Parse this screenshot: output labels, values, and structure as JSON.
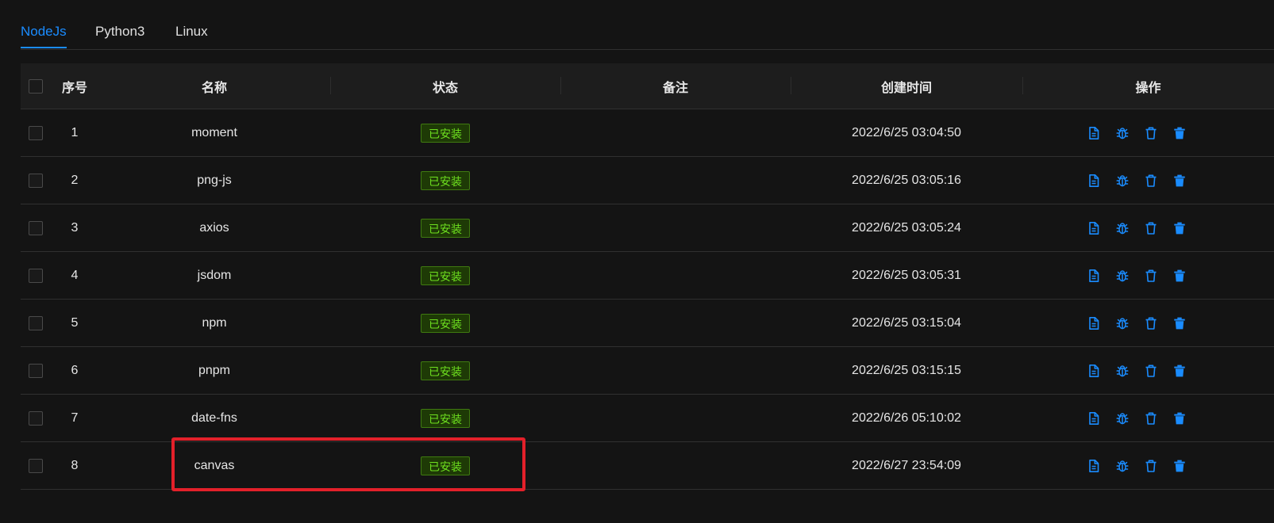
{
  "tabs": [
    {
      "label": "NodeJs",
      "active": true
    },
    {
      "label": "Python3",
      "active": false
    },
    {
      "label": "Linux",
      "active": false
    }
  ],
  "table": {
    "columns": {
      "index": "序号",
      "name": "名称",
      "status": "状态",
      "note": "备注",
      "created": "创建时间",
      "ops": "操作"
    },
    "rows": [
      {
        "index": "1",
        "name": "moment",
        "status": "已安装",
        "note": "",
        "created": "2022/6/25 03:04:50"
      },
      {
        "index": "2",
        "name": "png-js",
        "status": "已安装",
        "note": "",
        "created": "2022/6/25 03:05:16"
      },
      {
        "index": "3",
        "name": "axios",
        "status": "已安装",
        "note": "",
        "created": "2022/6/25 03:05:24"
      },
      {
        "index": "4",
        "name": "jsdom",
        "status": "已安装",
        "note": "",
        "created": "2022/6/25 03:05:31"
      },
      {
        "index": "5",
        "name": "npm",
        "status": "已安装",
        "note": "",
        "created": "2022/6/25 03:15:04"
      },
      {
        "index": "6",
        "name": "pnpm",
        "status": "已安装",
        "note": "",
        "created": "2022/6/25 03:15:15"
      },
      {
        "index": "7",
        "name": "date-fns",
        "status": "已安装",
        "note": "",
        "created": "2022/6/26 05:10:02"
      },
      {
        "index": "8",
        "name": "canvas",
        "status": "已安装",
        "note": "",
        "created": "2022/6/27 23:54:09"
      }
    ],
    "row_actions": [
      "log-icon",
      "debug-icon",
      "uninstall-icon",
      "delete-icon"
    ]
  },
  "colors": {
    "accent": "#1a8cff",
    "status_installed_text": "#6ee01f",
    "status_installed_bg": "#1e3a06",
    "highlight": "#e3202a"
  }
}
